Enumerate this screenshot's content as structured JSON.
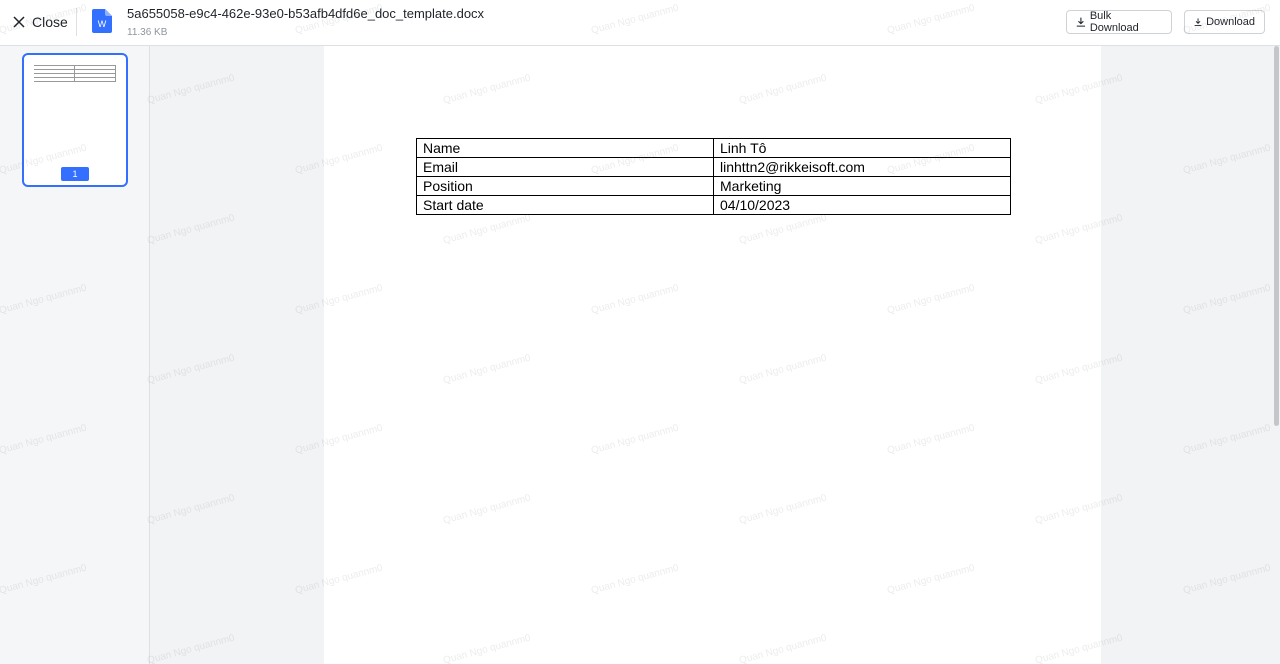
{
  "header": {
    "close_label": "Close",
    "file_name": "5a655058-e9c4-462e-93e0-b53afb4dfd6e_doc_template.docx",
    "file_size": "11.36 KB",
    "file_icon_letter": "W",
    "bulk_download_label": "Bulk Download",
    "download_label": "Download"
  },
  "sidebar": {
    "pages": [
      {
        "number": "1",
        "selected": true
      }
    ]
  },
  "document": {
    "rows": [
      {
        "label": "Name",
        "value": "Linh Tô"
      },
      {
        "label": "Email",
        "value": "linhttn2@rikkeisoft.com"
      },
      {
        "label": "Position",
        "value": "Marketing"
      },
      {
        "label": "Start date",
        "value": "04/10/2023"
      }
    ]
  },
  "watermark": "Quan Ngo quannm0",
  "colors": {
    "accent": "#3370ff",
    "word_icon": "#3370ff"
  }
}
